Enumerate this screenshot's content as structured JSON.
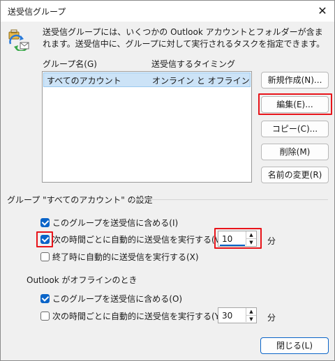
{
  "window": {
    "title": "送受信グループ"
  },
  "description": "送受信グループには、いくつかの Outlook アカウントとフォルダーが含まれます。送受信中に、グループに対して実行されるタスクを指定できます。",
  "list": {
    "col_name": "グループ名(G)",
    "col_timing": "送受信するタイミング",
    "rows": [
      {
        "name": "すべてのアカウント",
        "timing": "オンライン と オフライン"
      }
    ]
  },
  "buttons": {
    "new": "新規作成(N)...",
    "edit": "編集(E)...",
    "copy": "コピー(C)...",
    "delete": "削除(M)",
    "rename": "名前の変更(R)",
    "close": "閉じる(L)"
  },
  "settings": {
    "group_title": "グループ \"すべてのアカウント\" の設定",
    "online": {
      "include": {
        "label": "このグループを送受信に含める(I)",
        "checked": true
      },
      "schedule": {
        "label": "次の時間ごとに自動的に送受信を実行する(V)",
        "checked": true,
        "value": "10",
        "unit": "分"
      },
      "on_exit": {
        "label": "終了時に自動的に送受信を実行する(X)",
        "checked": false
      }
    },
    "offline_title": "Outlook がオフラインのとき",
    "offline": {
      "include": {
        "label": "このグループを送受信に含める(O)",
        "checked": true
      },
      "schedule": {
        "label": "次の時間ごとに自動的に送受信を実行する(Y)",
        "checked": false,
        "value": "30",
        "unit": "分"
      }
    }
  },
  "colors": {
    "accent": "#0a64c8",
    "highlight": "#e8141a",
    "selection": "#cce3f7"
  }
}
